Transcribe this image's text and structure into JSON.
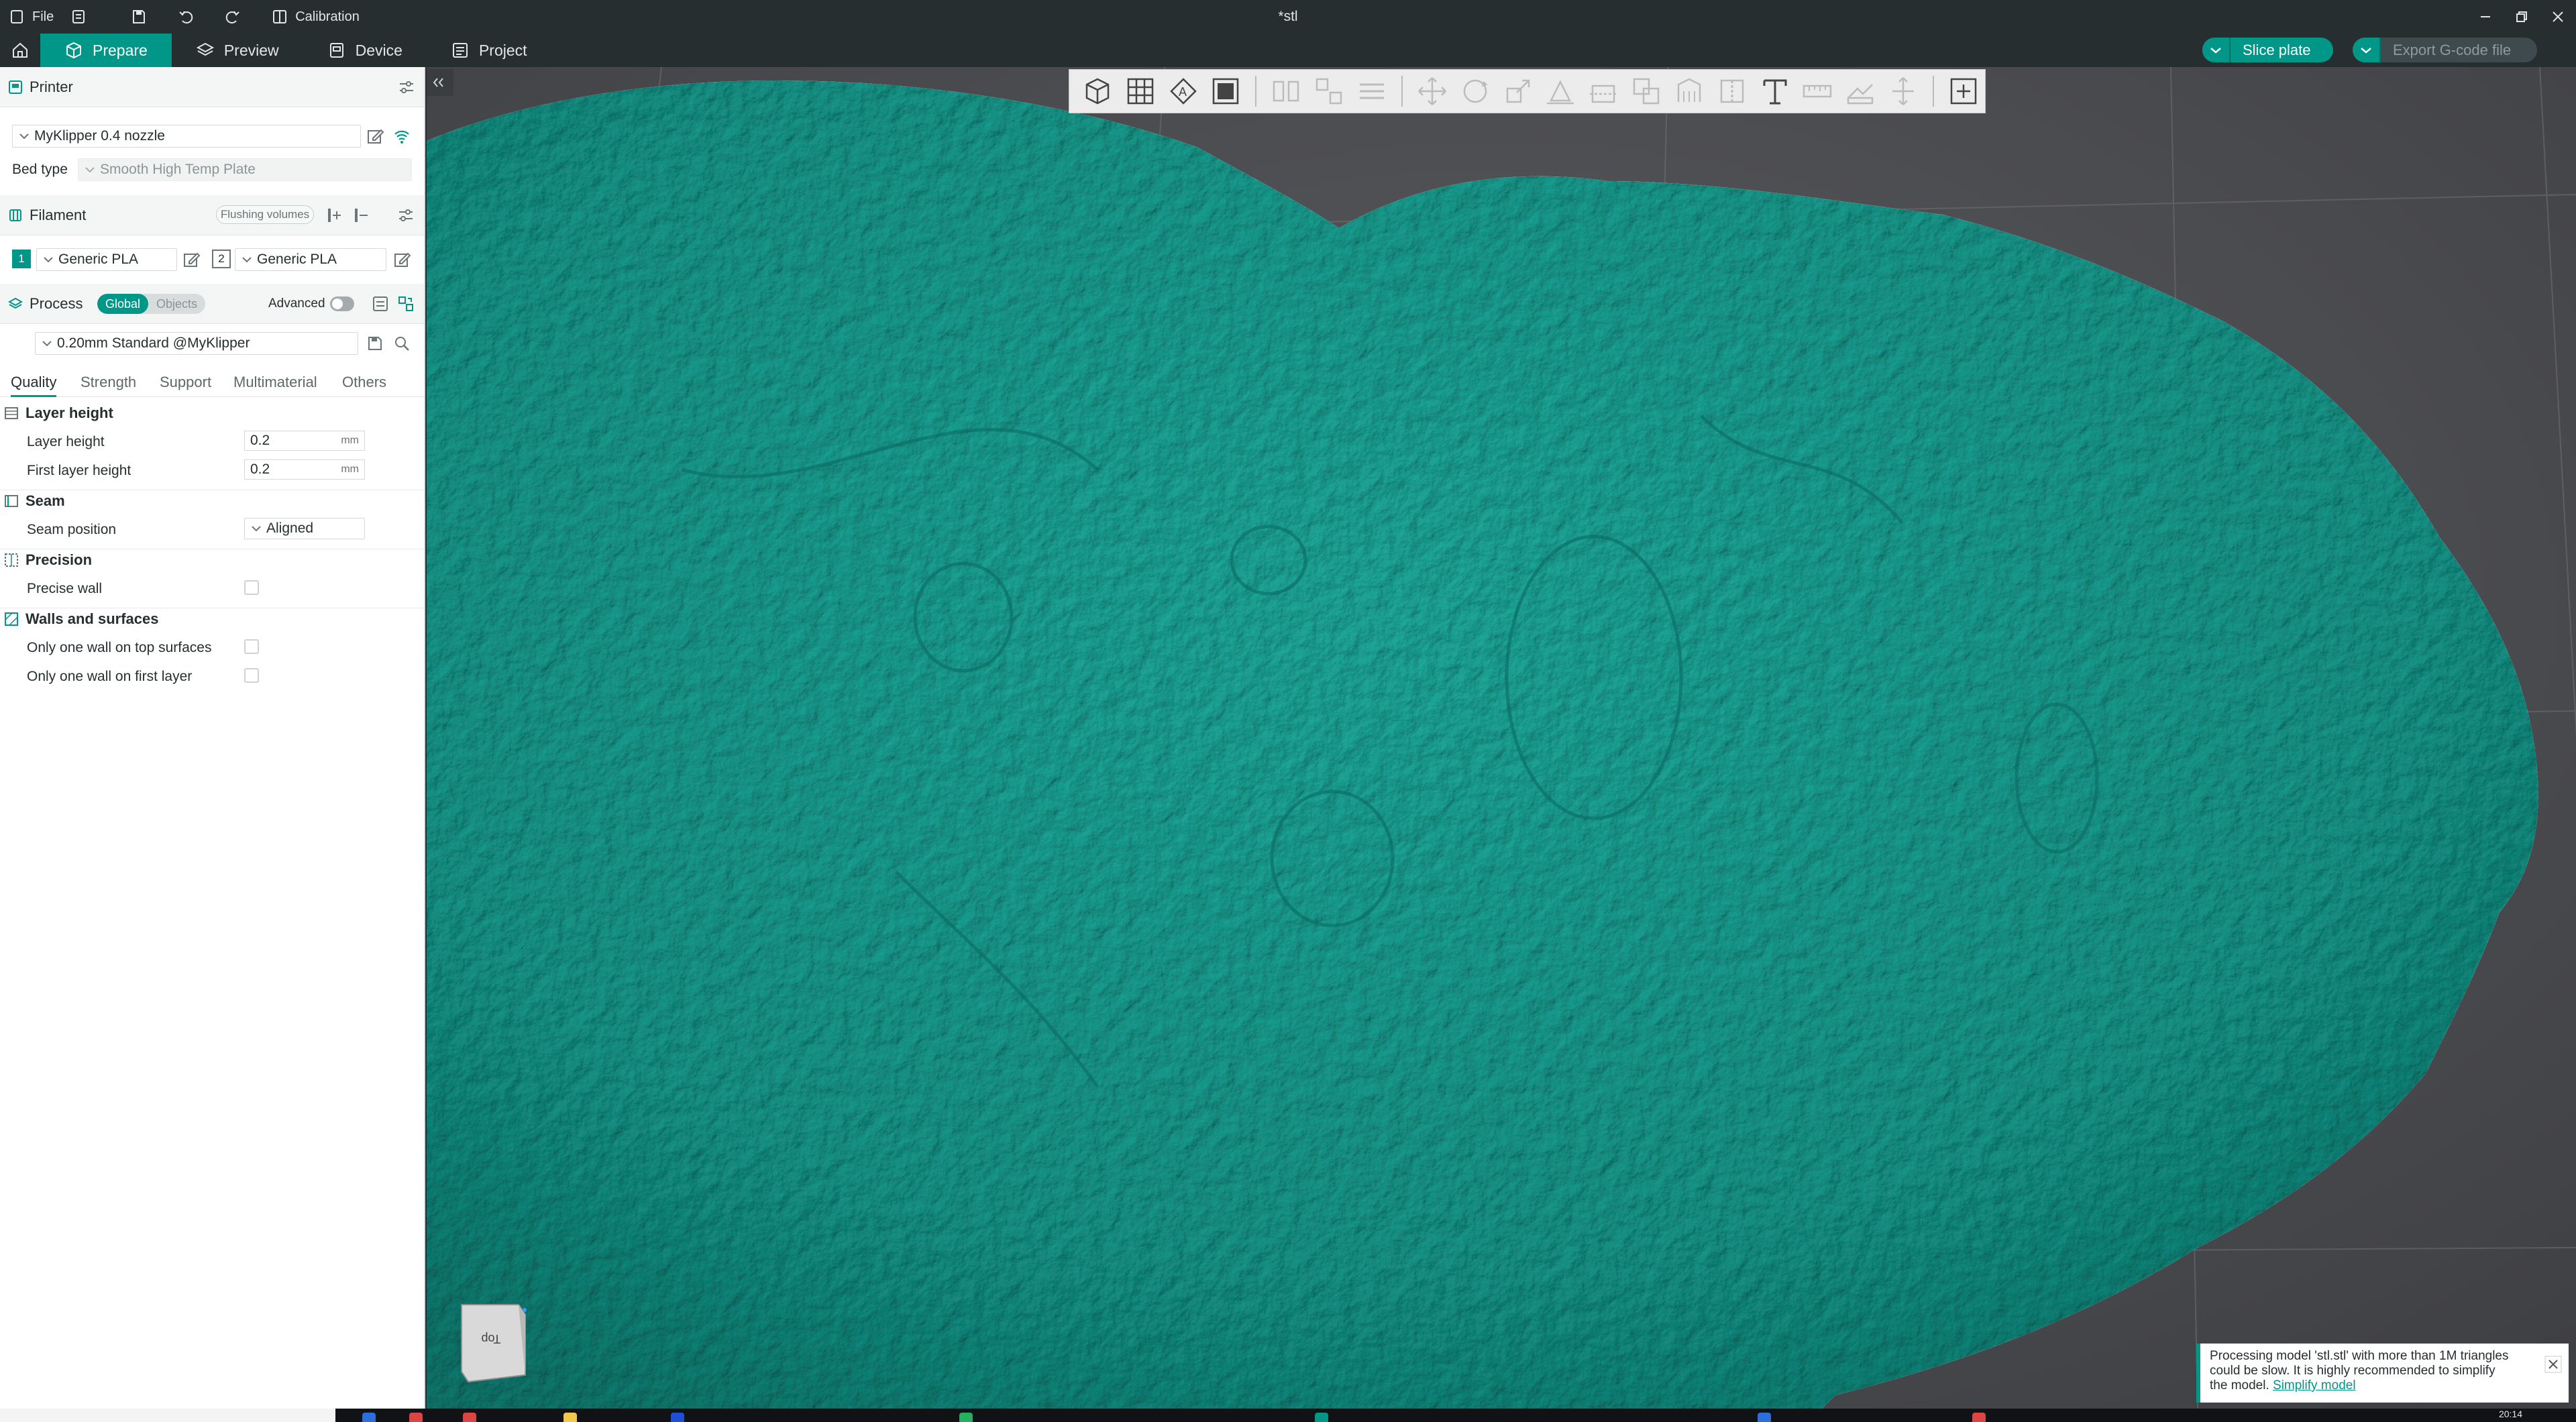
{
  "titlebar": {
    "file_label": "File",
    "calibration_label": "Calibration",
    "doc_title": "*stl"
  },
  "tabs": [
    {
      "label": "Prepare",
      "icon": "cube-icon",
      "active": true
    },
    {
      "label": "Preview",
      "icon": "layers-icon",
      "active": false
    },
    {
      "label": "Device",
      "icon": "device-icon",
      "active": false
    },
    {
      "label": "Project",
      "icon": "project-icon",
      "active": false
    }
  ],
  "actions": {
    "slice_label": "Slice plate",
    "export_label": "Export G-code file"
  },
  "printer": {
    "title": "Printer",
    "name": "MyKlipper 0.4 nozzle",
    "bed_type_label": "Bed type",
    "bed_type_value": "Smooth High Temp Plate"
  },
  "filament": {
    "title": "Filament",
    "flushing_label": "Flushing volumes",
    "slots": [
      {
        "index": "1",
        "name": "Generic PLA",
        "color": "#009688"
      },
      {
        "index": "2",
        "name": "Generic PLA",
        "color": "#ffffff"
      }
    ]
  },
  "process": {
    "title": "Process",
    "global_label": "Global",
    "objects_label": "Objects",
    "advanced_label": "Advanced",
    "advanced_on": false,
    "preset": "0.20mm Standard @MyKlipper"
  },
  "settings_tabs": [
    "Quality",
    "Strength",
    "Support",
    "Multimaterial",
    "Others"
  ],
  "quality": {
    "layer_height_group": "Layer height",
    "layer_height_label": "Layer height",
    "layer_height_value": "0.2",
    "first_layer_height_label": "First layer height",
    "first_layer_height_value": "0.2",
    "unit": "mm",
    "seam_group": "Seam",
    "seam_position_label": "Seam position",
    "seam_position_value": "Aligned",
    "precision_group": "Precision",
    "precise_wall_label": "Precise wall",
    "precise_wall_checked": false,
    "walls_group": "Walls and surfaces",
    "one_wall_top_label": "Only one wall on top surfaces",
    "one_wall_top_checked": false,
    "one_wall_first_label": "Only one wall on first layer",
    "one_wall_first_checked": false
  },
  "viewport": {
    "model_color": "#1aa396",
    "background_color": "#4a4b4f",
    "view_cube_label": "Top"
  },
  "notification": {
    "line1": "Processing model 'stl.stl' with more than 1M triangles",
    "line2": "could be slow. It is highly recommended to simplify",
    "line3_prefix": "the model.",
    "link": "Simplify model"
  },
  "taskbar": {
    "clock": "20:14"
  },
  "colors": {
    "accent": "#009688",
    "titlebar": "#262e30",
    "panel_header": "#f4f5f5"
  }
}
